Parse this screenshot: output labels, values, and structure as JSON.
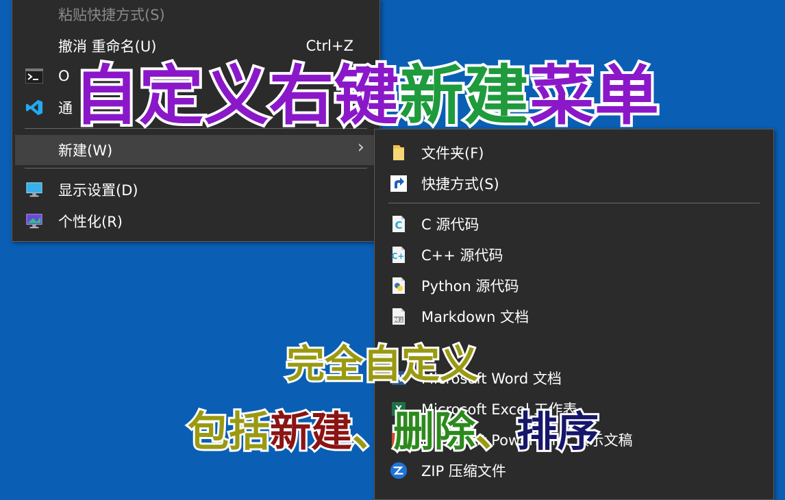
{
  "main_menu": {
    "items": [
      {
        "label": "粘贴快捷方式(S)",
        "shortcut": ""
      },
      {
        "label": "撤消 重命名(U)",
        "shortcut": "Ctrl+Z"
      },
      {
        "label": "O",
        "shortcut": ""
      },
      {
        "label": "通",
        "shortcut": ""
      },
      {
        "label": "新建(W)",
        "shortcut": ""
      },
      {
        "label": "显示设置(D)",
        "shortcut": ""
      },
      {
        "label": "个性化(R)",
        "shortcut": ""
      }
    ]
  },
  "sub_menu": {
    "items": [
      {
        "label": "文件夹(F)",
        "icon": "folder-icon"
      },
      {
        "label": "快捷方式(S)",
        "icon": "shortcut-icon"
      },
      {
        "label": "C 源代码",
        "icon": "c-file-icon"
      },
      {
        "label": "C++ 源代码",
        "icon": "cpp-file-icon"
      },
      {
        "label": "Python 源代码",
        "icon": "python-file-icon"
      },
      {
        "label": "Markdown 文档",
        "icon": "markdown-file-icon"
      },
      {
        "label": "Microsoft Word 文档",
        "icon": "word-icon"
      },
      {
        "label": "Microsoft Excel 工作表",
        "icon": "excel-icon"
      },
      {
        "label": "Microsoft PowerPoint 演示文稿",
        "icon": "powerpoint-icon"
      },
      {
        "label": "ZIP 压缩文件",
        "icon": "zip-icon"
      }
    ]
  },
  "overlay": {
    "title": {
      "part1": "自定义右键",
      "part2": "新建",
      "part3": "菜单"
    },
    "sub1": "完全自定义",
    "sub2": {
      "p1": "包括",
      "p2": "新建",
      "p3": "、",
      "p4": "删除",
      "p5": "、",
      "p6": "排序"
    }
  },
  "colors": {
    "desktop": "#0a5fb4",
    "menu_bg": "#2b2b2b",
    "title_purple": "#8a18c8",
    "title_green": "#1f9a3c",
    "sub_olive": "#9a9a12",
    "sub_red": "#8b1414",
    "sub_green": "#2c8a1c",
    "sub_navy": "#16166a"
  }
}
